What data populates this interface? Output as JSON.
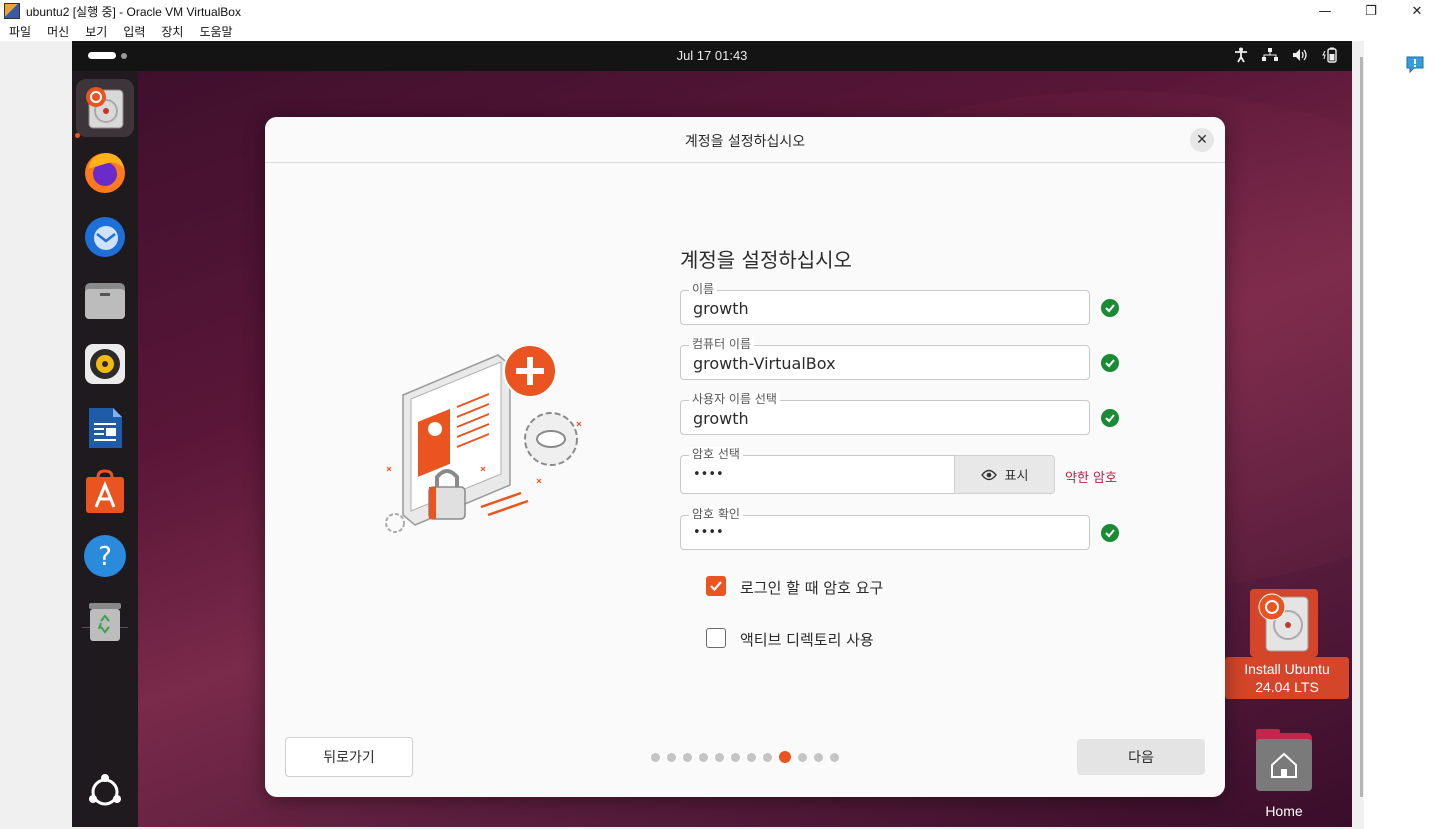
{
  "host": {
    "window_title": "ubuntu2 [실행 중] - Oracle VM VirtualBox",
    "menu": [
      "파일",
      "머신",
      "보기",
      "입력",
      "장치",
      "도움말"
    ]
  },
  "guest": {
    "clock": "Jul 17  01:43",
    "desktop": {
      "install_label_line1": "Install Ubuntu",
      "install_label_line2": "24.04 LTS",
      "home_label": "Home"
    }
  },
  "dialog": {
    "header_title": "계정을 설정하십시오",
    "form_title": "계정을 설정하십시오",
    "fields": {
      "name": {
        "label": "이름",
        "value": "growth"
      },
      "computer_name": {
        "label": "컴퓨터 이름",
        "value": "growth-VirtualBox"
      },
      "username": {
        "label": "사용자 이름 선택",
        "value": "growth"
      },
      "password": {
        "label": "암호 선택",
        "value": "••••"
      },
      "password_confirm": {
        "label": "암호 확인",
        "value": "••••"
      }
    },
    "show_button": "표시",
    "password_strength": "약한 암호",
    "require_password": {
      "label": "로그인 할 때 암호 요구",
      "checked": true
    },
    "active_directory": {
      "label": "액티브 디렉토리 사용",
      "checked": false
    },
    "back_button": "뒤로가기",
    "next_button": "다음",
    "progress": {
      "total_steps": 12,
      "current_step": 9
    }
  },
  "colors": {
    "accent": "#e95420",
    "ok": "#1a8a35",
    "weak": "#b0234a"
  }
}
